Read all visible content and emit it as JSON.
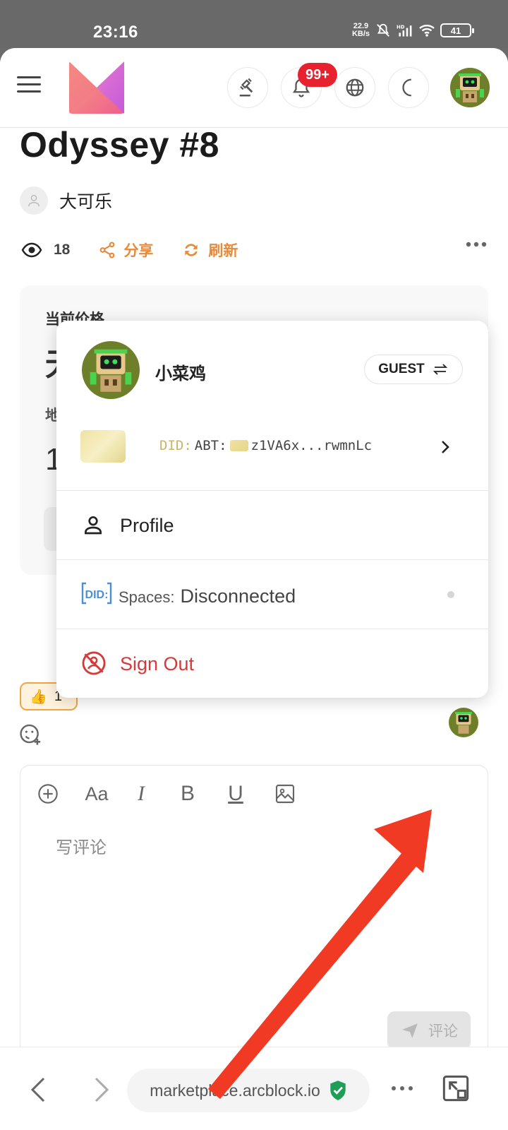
{
  "status_bar": {
    "time": "23:16",
    "speed_value": "22.9",
    "speed_unit": "KB/s",
    "battery": "41"
  },
  "header": {
    "notification_badge": "99+"
  },
  "article": {
    "title": "Odyssey #8",
    "author": "大可乐",
    "views": "18",
    "share_label": "分享",
    "refresh_label": "刷新"
  },
  "price_card": {
    "price_label": "当前价格",
    "price_value": "无",
    "address_label": "地",
    "address_value": "1"
  },
  "reactions": {
    "thumbs_emoji": "👍",
    "thumbs_count": "1"
  },
  "editor": {
    "placeholder": "写评论",
    "submit_label": "评论",
    "toolbar": {
      "add": "+",
      "font": "Aa",
      "italic": "I",
      "bold": "B",
      "underline": "U"
    }
  },
  "user_menu": {
    "user_name": "小菜鸡",
    "role_button": "GUEST",
    "did_prefix": "DID:",
    "did_chain": "ABT:",
    "did_address": "z1VA6x...rwmnLc",
    "profile_label": "Profile",
    "spaces_badge": "DID:",
    "spaces_key": "Spaces:",
    "spaces_value": "Disconnected",
    "sign_out_label": "Sign Out"
  },
  "browser": {
    "url": "marketplace.arcblock.io"
  },
  "colors": {
    "accent_orange": "#e88a3a",
    "badge_red": "#e8212e",
    "sign_out_red": "#d43a3a",
    "verified_green": "#1e9e57",
    "annotation_arrow": "#f03a24"
  }
}
